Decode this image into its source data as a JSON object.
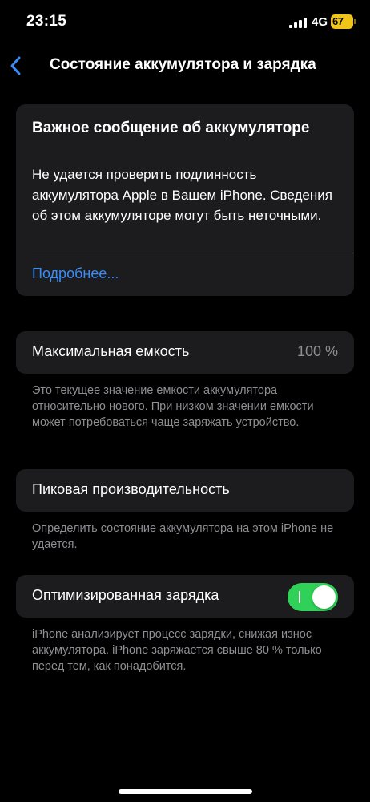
{
  "status_bar": {
    "time": "23:15",
    "network": "4G",
    "battery_text": "67",
    "battery_color": "#f0c419"
  },
  "nav": {
    "back_icon": "chevron-left-icon",
    "title": "Состояние аккумулятора и зарядка"
  },
  "alert": {
    "title": "Важное сообщение об аккумуляторе",
    "body": "Не удается проверить подлинность аккумулятора Apple в Вашем iPhone. Сведения об этом аккумуляторе могут быть неточными.",
    "link": "Подробнее..."
  },
  "max_capacity": {
    "label": "Максимальная емкость",
    "value": "100 %",
    "footnote": "Это текущее значение емкости аккумулятора относительно нового. При низком значении емкости может потребоваться чаще заряжать устройство."
  },
  "peak_performance": {
    "label": "Пиковая производительность",
    "footnote": "Определить состояние аккумулятора на этом iPhone не удается."
  },
  "optimized_charging": {
    "label": "Оптимизированная зарядка",
    "enabled": true,
    "footnote": "iPhone анализирует процесс зарядки, снижая износ аккумулятора. iPhone заряжается свыше 80 % только перед тем, как понадобится."
  },
  "colors": {
    "accent": "#3a8cf7",
    "toggle_on": "#30d158",
    "card_bg": "#1c1c1e"
  }
}
